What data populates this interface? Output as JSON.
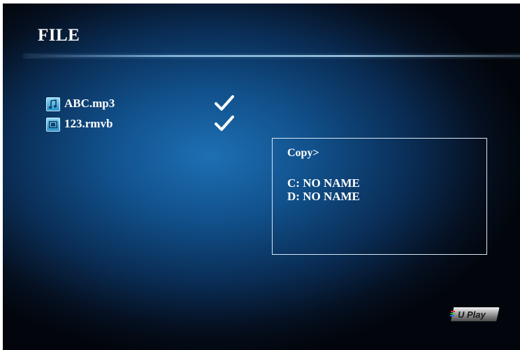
{
  "header": {
    "title": "FILE"
  },
  "files": [
    {
      "name": "ABC.mp3",
      "icon": "music-file-icon",
      "selected": true
    },
    {
      "name": "123.rmvb",
      "icon": "video-file-icon",
      "selected": true
    }
  ],
  "copy_menu": {
    "title": "Copy>",
    "drives": [
      "C: NO NAME",
      "D: NO NAME"
    ]
  },
  "brand": {
    "logo_text": "U Play"
  },
  "colors": {
    "accent": "#b7def5",
    "text": "#ffffff",
    "background": "#0a2e57"
  }
}
